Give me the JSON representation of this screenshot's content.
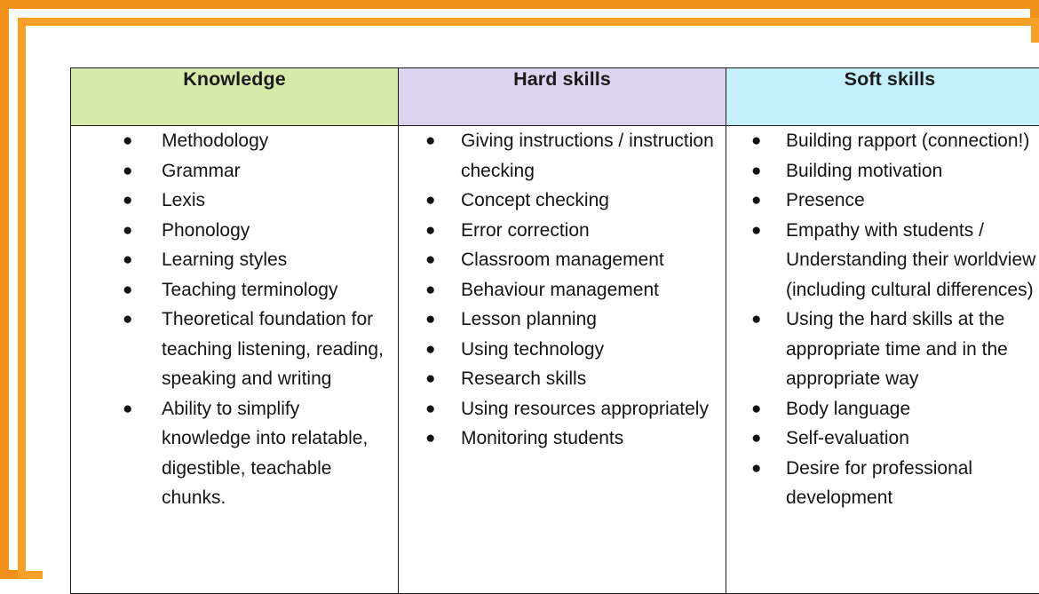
{
  "frame": {
    "outer_color": "#f0911b",
    "inner_color": "#f7a027",
    "page_color": "#ffffff"
  },
  "table": {
    "columns": [
      {
        "id": "knowledge",
        "header": "Knowledge",
        "header_color": "#d5eaab",
        "items": [
          "Methodology",
          "Grammar",
          "Lexis",
          "Phonology",
          "Learning styles",
          "Teaching terminology",
          "Theoretical foundation for teaching listening, reading, speaking and writing",
          "Ability to simplify knowledge into relatable, digestible, teachable chunks."
        ]
      },
      {
        "id": "hard-skills",
        "header": "Hard skills",
        "header_color": "#ddd4ef",
        "items": [
          "Giving instructions / instruction checking",
          "Concept checking",
          "Error correction",
          "Classroom management",
          "Behaviour management",
          "Lesson planning",
          "Using technology",
          "Research skills",
          "Using resources appropriately",
          "Monitoring students"
        ]
      },
      {
        "id": "soft-skills",
        "header": "Soft skills",
        "header_color": "#c4f0fc",
        "items": [
          "Building rapport (connection!)",
          "Building motivation",
          "Presence",
          "Empathy with students / Understanding their worldview (including cultural differences)",
          "Using the hard skills at the appropriate time and in the appropriate way",
          "Body language",
          "Self-evaluation",
          "Desire for professional development"
        ]
      }
    ],
    "bullet_glyph": "●"
  }
}
